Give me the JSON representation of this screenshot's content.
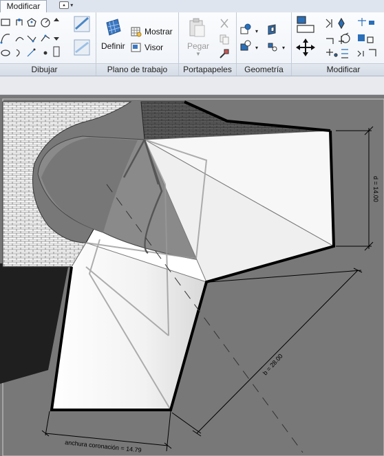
{
  "tabs": {
    "active": "Modificar"
  },
  "ribbon": {
    "panels": {
      "dibujar": "Dibujar",
      "plano": "Plano de trabajo",
      "portapapeles": "Portapapeles",
      "geometria": "Geometría",
      "modificar": "Modificar"
    },
    "buttons": {
      "definir": "Definir",
      "mostrar": "Mostrar",
      "visor": "Visor",
      "pegar": "Pegar"
    }
  },
  "drawing": {
    "dim_d": "d = 14.00",
    "dim_b": "b = 28.00",
    "dim_corona": "anchura coronación = 14.79"
  },
  "colors": {
    "accent": "#2a6fb8",
    "background": "#787878"
  }
}
